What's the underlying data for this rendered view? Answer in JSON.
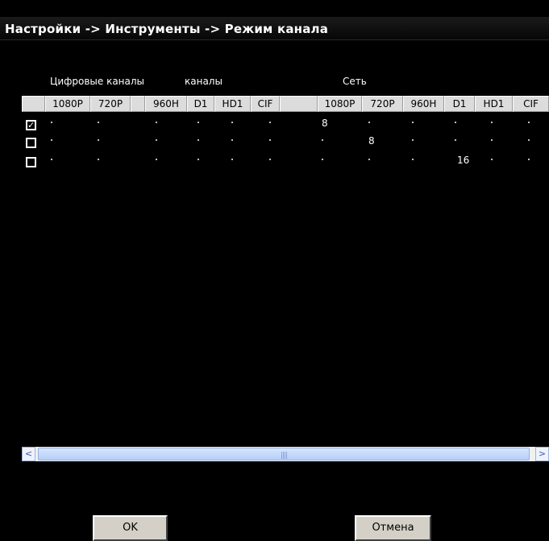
{
  "title": "Настройки -> Инструменты -> Режим канала",
  "sections": {
    "digital": "Цифровые каналы",
    "channels": "каналы",
    "network": "Сеть"
  },
  "columns": [
    "1080P",
    "720P",
    "",
    "960H",
    "D1",
    "HD1",
    "CIF",
    "",
    "1080P",
    "720P",
    "960H",
    "D1",
    "HD1",
    "CIF"
  ],
  "rows": [
    {
      "checked": true,
      "values": {
        "net_1080p": "8"
      }
    },
    {
      "checked": false,
      "values": {
        "net_720p": "8"
      }
    },
    {
      "checked": false,
      "values": {
        "net_d1": "16"
      }
    }
  ],
  "icons": {
    "checkbox_mark": "✓",
    "scroll_left": "<",
    "scroll_right": ">",
    "thumb_grip": "||||"
  },
  "buttons": {
    "ok": "OK",
    "cancel": "Отмена"
  }
}
